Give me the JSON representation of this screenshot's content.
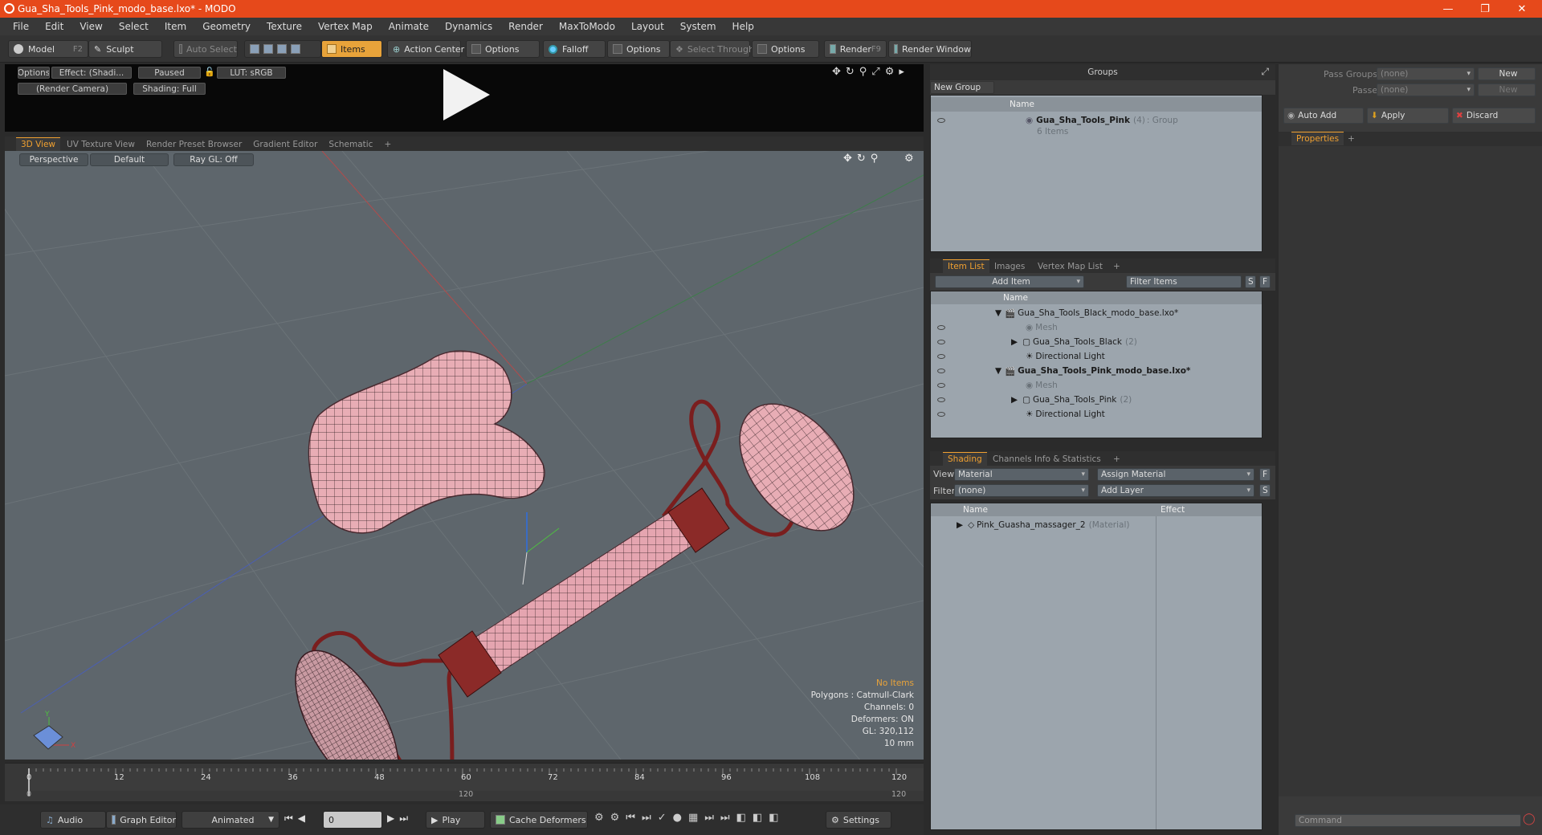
{
  "window": {
    "title": "Gua_Sha_Tools_Pink_modo_base.lxo* - MODO"
  },
  "menu": [
    "File",
    "Edit",
    "View",
    "Select",
    "Item",
    "Geometry",
    "Texture",
    "Vertex Map",
    "Animate",
    "Dynamics",
    "Render",
    "MaxToModo",
    "Layout",
    "System",
    "Help"
  ],
  "toolbar": {
    "model": "Model",
    "model_key": "F2",
    "sculpt": "Sculpt",
    "auto_select": "Auto Select",
    "items": "Items",
    "action_center": "Action Center",
    "options1": "Options",
    "falloff": "Falloff",
    "options2": "Options",
    "select_through": "Select Through",
    "options3": "Options",
    "render": "Render",
    "render_key": "F9",
    "render_window": "Render Window"
  },
  "preview": {
    "options": "Options",
    "effect": "Effect: (Shadi...",
    "paused": "Paused",
    "lut": "LUT: sRGB",
    "camera": "(Render Camera)",
    "shading": "Shading: Full"
  },
  "viewport_tabs": [
    "3D View",
    "UV Texture View",
    "Render Preset Browser",
    "Gradient Editor",
    "Schematic",
    "+"
  ],
  "viewport": {
    "perspective": "Perspective",
    "default": "Default",
    "raygl": "Ray GL: Off",
    "axis_y": "Y",
    "axis_x": "X",
    "stats": {
      "no_items": "No Items",
      "polygons": "Polygons : Catmull-Clark",
      "channels": "Channels: 0",
      "deformers": "Deformers: ON",
      "gl": "GL: 320,112",
      "unit": "10 mm"
    }
  },
  "timeline": {
    "ticks": [
      "0",
      "12",
      "24",
      "36",
      "48",
      "60",
      "72",
      "84",
      "96",
      "108",
      "120"
    ],
    "sub": [
      "0",
      "120",
      "120"
    ]
  },
  "bottombar": {
    "audio": "Audio",
    "graph_editor": "Graph Editor",
    "animated": "Animated",
    "frame": "0",
    "play": "Play",
    "cache": "Cache Deformers",
    "settings": "Settings"
  },
  "groups": {
    "title": "Groups",
    "new_group": "New Group",
    "col_name": "Name",
    "item_name": "Gua_Sha_Tools_Pink",
    "item_count": "(4)",
    "item_type": ": Group",
    "item_sub": "6 Items"
  },
  "item_list": {
    "tabs": [
      "Item List",
      "Images",
      "Vertex Map List",
      "+"
    ],
    "add_item": "Add Item",
    "filter": "Filter Items",
    "s": "S",
    "f": "F",
    "col_name": "Name",
    "rows": [
      {
        "label": "Gua_Sha_Tools_Black_modo_base.lxo*"
      },
      {
        "label": "Mesh"
      },
      {
        "label": "Gua_Sha_Tools_Black",
        "count": "(2)"
      },
      {
        "label": "Directional Light"
      },
      {
        "label": "Gua_Sha_Tools_Pink_modo_base.lxo*"
      },
      {
        "label": "Mesh"
      },
      {
        "label": "Gua_Sha_Tools_Pink",
        "count": "(2)"
      },
      {
        "label": "Directional Light"
      }
    ]
  },
  "shading": {
    "tabs": [
      "Shading",
      "Channels",
      "Info & Statistics",
      "+"
    ],
    "view_label": "View",
    "view_value": "Material",
    "assign": "Assign Material",
    "f": "F",
    "filter_label": "Filter",
    "filter_value": "(none)",
    "add_layer": "Add Layer",
    "s": "S",
    "col_name": "Name",
    "col_effect": "Effect",
    "row_name": "Pink_Guasha_massager_2",
    "row_type": "(Material)"
  },
  "right": {
    "pass_groups": "Pass Groups",
    "pass_groups_val": "(none)",
    "new1": "New",
    "passes": "Passes",
    "passes_val": "(none)",
    "new2": "New",
    "auto_add": "Auto Add",
    "apply": "Apply",
    "discard": "Discard",
    "properties": "Properties",
    "plus": "+",
    "command": "Command"
  }
}
